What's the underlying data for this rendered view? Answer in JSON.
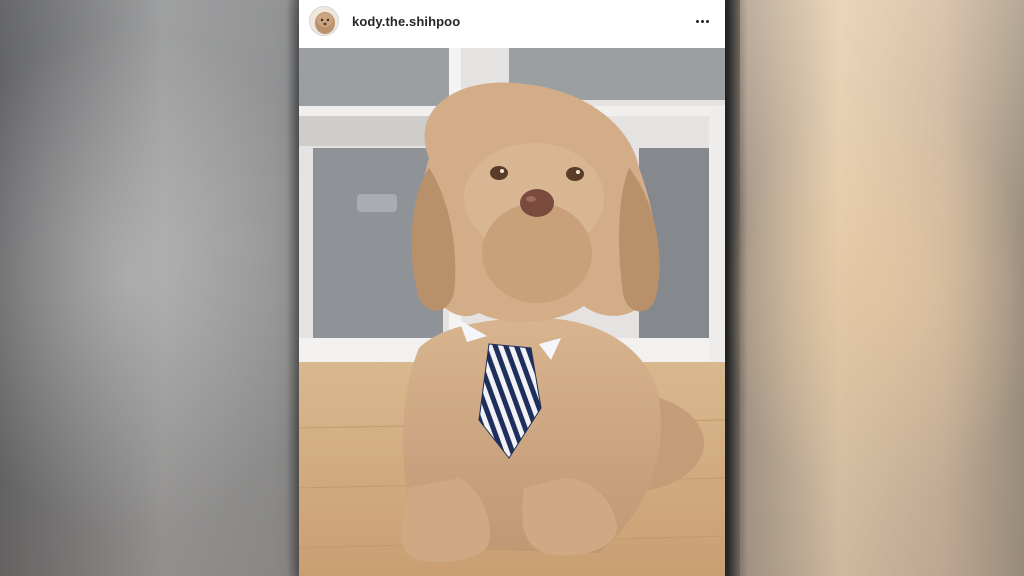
{
  "post": {
    "username": "kody.the.shihpoo",
    "avatar_icon": "dog-avatar-icon",
    "more_icon": "more-options-icon"
  },
  "colors": {
    "header_bg": "#ffffff",
    "username_text": "#262626",
    "fur": "#c9a27e",
    "tie_stripe_dark": "#1f2f5c"
  }
}
